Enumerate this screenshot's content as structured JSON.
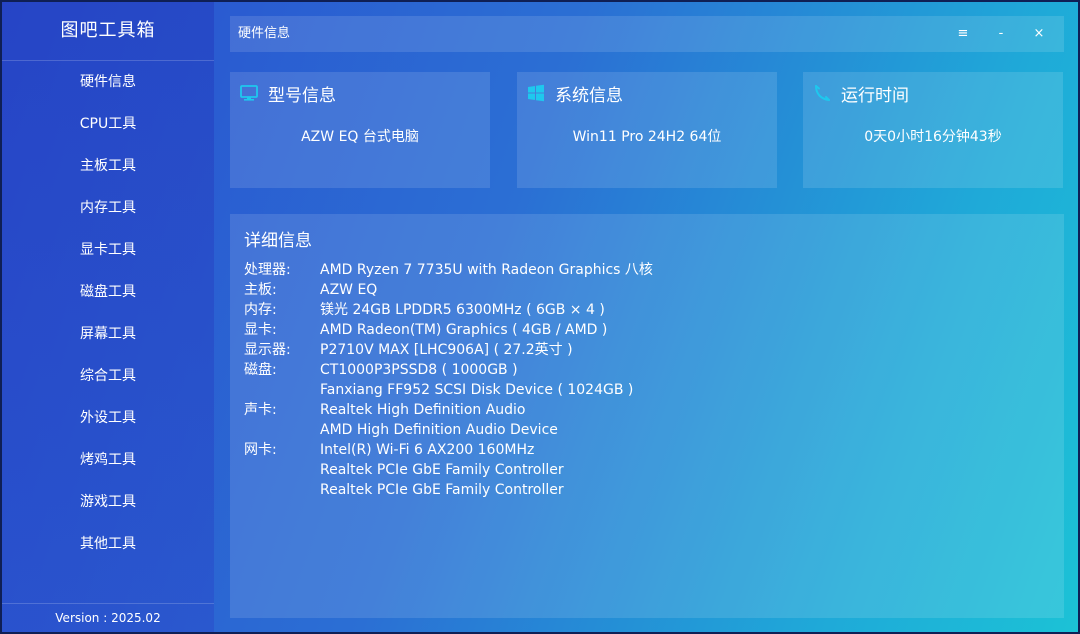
{
  "app": {
    "brand": "图吧工具箱",
    "version": "Version : 2025.02"
  },
  "sidebar": {
    "items": [
      {
        "label": "硬件信息"
      },
      {
        "label": "CPU工具"
      },
      {
        "label": "主板工具"
      },
      {
        "label": "内存工具"
      },
      {
        "label": "显卡工具"
      },
      {
        "label": "磁盘工具"
      },
      {
        "label": "屏幕工具"
      },
      {
        "label": "综合工具"
      },
      {
        "label": "外设工具"
      },
      {
        "label": "烤鸡工具"
      },
      {
        "label": "游戏工具"
      },
      {
        "label": "其他工具"
      }
    ]
  },
  "titlebar": {
    "title": "硬件信息",
    "menu_glyph": "≡",
    "minimize_glyph": "-",
    "close_glyph": "×"
  },
  "cards": {
    "model": {
      "title": "型号信息",
      "value": "AZW EQ 台式电脑",
      "icon": "monitor-icon"
    },
    "system": {
      "title": "系统信息",
      "value": "Win11 Pro 24H2 64位",
      "icon": "windows-icon"
    },
    "uptime": {
      "title": "运行时间",
      "value": "0天0小时16分钟43秒",
      "icon": "uptime-icon"
    }
  },
  "details": {
    "title": "详细信息",
    "rows": [
      {
        "label": "处理器:",
        "value": "AMD Ryzen 7 7735U with Radeon Graphics 八核"
      },
      {
        "label": "主板:",
        "value": "AZW EQ"
      },
      {
        "label": "内存:",
        "value": "镁光 24GB LPDDR5 6300MHz ( 6GB × 4 )"
      },
      {
        "label": "显卡:",
        "value": "AMD Radeon(TM) Graphics ( 4GB / AMD )"
      },
      {
        "label": "显示器:",
        "value": "P2710V MAX [LHC906A] ( 27.2英寸 )"
      },
      {
        "label": "磁盘:",
        "value": "CT1000P3PSSD8 ( 1000GB )"
      },
      {
        "label": "",
        "value": "Fanxiang FF952 SCSI Disk Device ( 1024GB )"
      },
      {
        "label": "声卡:",
        "value": "Realtek High Definition Audio"
      },
      {
        "label": "",
        "value": "AMD High Definition Audio Device"
      },
      {
        "label": "网卡:",
        "value": "Intel(R) Wi-Fi 6 AX200 160MHz"
      },
      {
        "label": "",
        "value": "Realtek PCIe GbE Family Controller"
      },
      {
        "label": "",
        "value": "Realtek PCIe GbE Family Controller"
      }
    ]
  },
  "colors": {
    "gradient_start": "#2a4fcf",
    "gradient_end": "#1cc2d6",
    "text": "#ffffff"
  }
}
